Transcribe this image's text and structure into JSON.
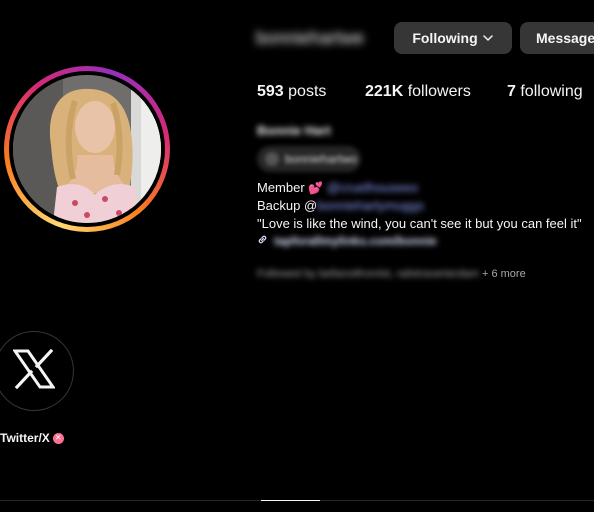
{
  "profile": {
    "username": "bonniehartwe",
    "full_name": "Bonnie Hart",
    "threads_handle": "bonniehartwo"
  },
  "actions": {
    "following_label": "Following",
    "message_label": "Message"
  },
  "stats": {
    "posts_count": "593",
    "posts_label": "posts",
    "followers_count": "221K",
    "followers_label": "followers",
    "following_count": "7",
    "following_label": "following"
  },
  "bio": {
    "member_prefix": "Member",
    "member_handle": "@cruelhouseeo",
    "backup_prefix": "Backup @",
    "backup_handle": "bonniehartymuggs",
    "quote": "\"Love is like the wind, you can't see it but you can feel it\"",
    "link": "tapforallmylinks.com/bonnie"
  },
  "followed_by": {
    "names": "Followed by bellanotfromlst, railstraverterdam",
    "more": "+ 6 more"
  },
  "highlights": [
    {
      "label": "Twitter/X",
      "icon": "x-logo-icon"
    }
  ],
  "colors": {
    "background": "#000000",
    "button_bg": "#363636",
    "link_blue": "#8fa0ff",
    "story_ring_start": "#feda75",
    "story_ring_end": "#962fbf"
  }
}
